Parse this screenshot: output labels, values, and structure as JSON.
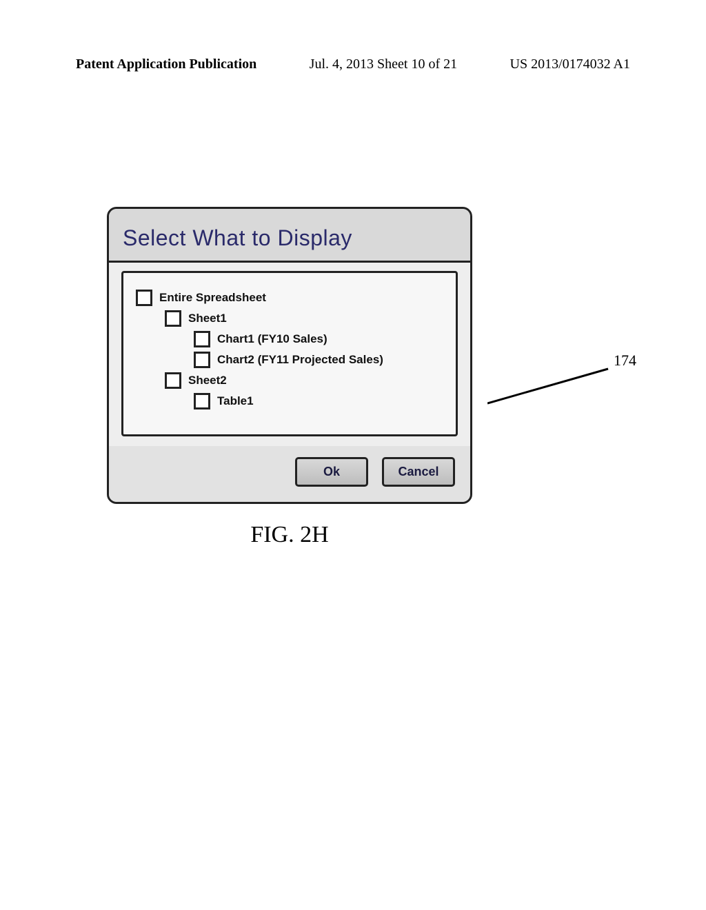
{
  "header": {
    "left": "Patent Application Publication",
    "mid": "Jul. 4, 2013   Sheet 10 of 21",
    "right": "US 2013/0174032 A1"
  },
  "dialog": {
    "title": "Select What to Display",
    "tree": {
      "root": "Entire Spreadsheet",
      "sheetA": "Sheet1",
      "chart1": "Chart1 (FY10 Sales)",
      "chart2": "Chart2 (FY11 Projected Sales)",
      "sheetB": "Sheet2",
      "table1": "Table1"
    },
    "buttons": {
      "ok": "Ok",
      "cancel": "Cancel"
    }
  },
  "callout": {
    "ref": "174"
  },
  "figure": {
    "caption": "FIG. 2H"
  }
}
